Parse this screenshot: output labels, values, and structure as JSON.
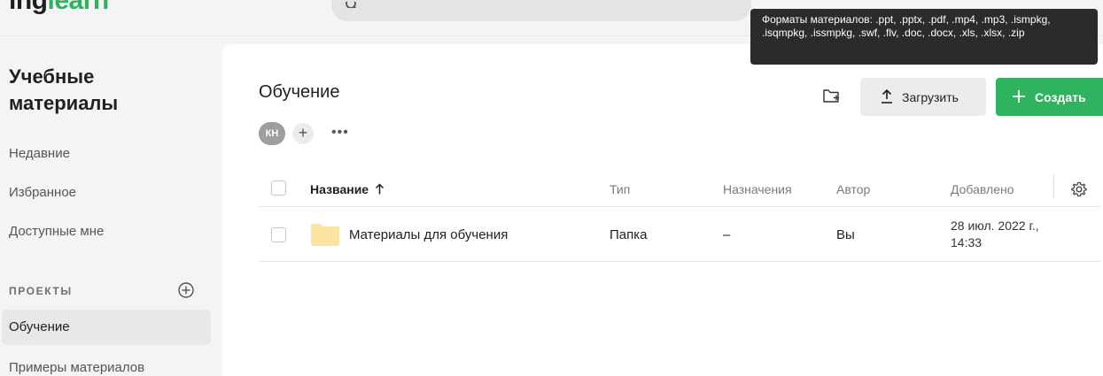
{
  "app": {
    "logo_part1": "ing",
    "logo_part2": "learn",
    "search_placeholder": ""
  },
  "tooltip": {
    "text": "Форматы материалов: .ppt, .pptx, .pdf, .mp4, .mp3, .ismpkg, .isqmpkg, .issmpkg, .swf, .flv, .doc, .docx, .xls, .xlsx, .zip"
  },
  "sidebar": {
    "title": "Учебные материалы",
    "items": [
      {
        "label": "Недавние",
        "active": false
      },
      {
        "label": "Избранное",
        "active": false
      },
      {
        "label": "Доступные мне",
        "active": false
      }
    ],
    "projects_heading": "ПРОЕКТЫ",
    "projects": [
      {
        "label": "Обучение",
        "active": true
      },
      {
        "label": "Примеры материалов",
        "active": false
      }
    ]
  },
  "main": {
    "title": "Обучение",
    "members": {
      "avatar_initials": "КН",
      "add_label": "+",
      "more_label": "•••"
    },
    "toolbar": {
      "new_folder_icon": "folder-plus-icon",
      "upload_label": "Загрузить",
      "create_label": "Создать"
    },
    "table": {
      "columns": {
        "name": "Название",
        "type": "Тип",
        "assignments": "Назначения",
        "author": "Автор",
        "added": "Добавлено"
      },
      "sort": "name-ascending",
      "rows": [
        {
          "name": "Материалы для обучения",
          "type": "Папка",
          "assignments": "–",
          "author": "Вы",
          "added": "28 июл. 2022 г., 14:33",
          "icon": "folder-icon"
        }
      ]
    }
  },
  "colors": {
    "accent": "#2fb35f",
    "sidebar_bg": "#f4f4f4",
    "tooltip_bg": "#2b2b2b",
    "folder": "#fbe3a1"
  }
}
